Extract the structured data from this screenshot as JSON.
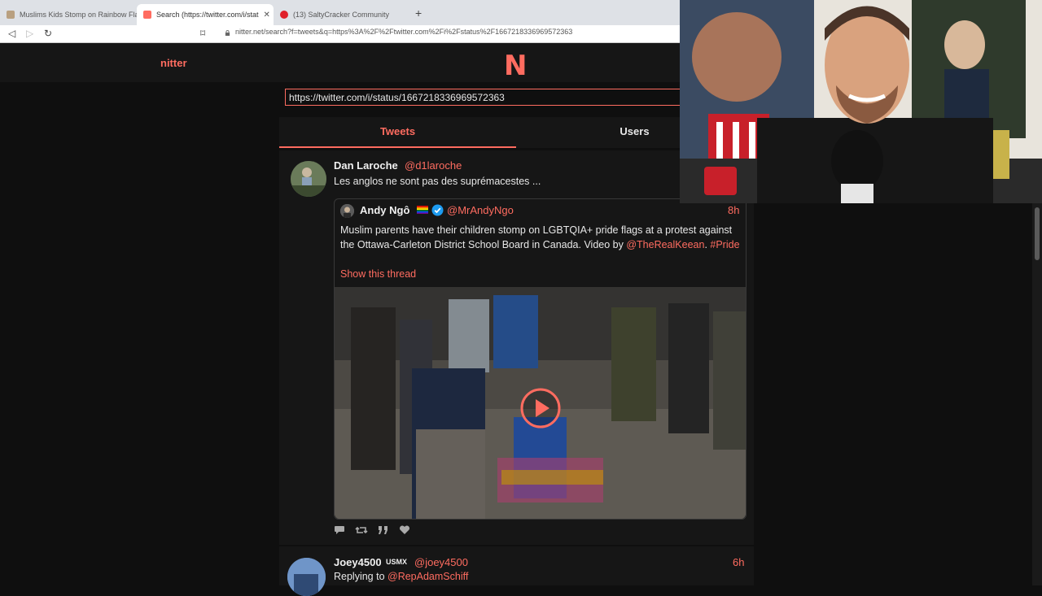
{
  "browser": {
    "tabs": [
      {
        "title": "Muslims Kids Stomp on Rainbow Flag"
      },
      {
        "title": "Search (https://twitter.com/i/stat"
      },
      {
        "title": "(13) SaltyCracker Community"
      }
    ],
    "new_tab_glyph": "+",
    "address": "nitter.net/search?f=tweets&q=https%3A%2F%2Ftwitter.com%2Fi%2Fstatus%2F1667218336969572363",
    "nav_glyphs": {
      "back": "◁",
      "forward": "▷",
      "reload": "↻",
      "bookmark": "⌑"
    }
  },
  "nitter": {
    "brand": "nitter",
    "logo_letter": "N",
    "search_value": "https://twitter.com/i/status/1667218336969572363",
    "tabs": {
      "tweets": "Tweets",
      "users": "Users"
    }
  },
  "tweet": {
    "name": "Dan Laroche",
    "handle": "@d1laroche",
    "text": "Les anglos ne sont pas des suprémacestes ...",
    "quote": {
      "name": "Andy Ngô",
      "handle": "@MrAndyNgo",
      "time": "8h",
      "text_part1": "Muslim parents have their children stomp on LGBTQIA+ pride flags at a protest against the Ottawa-Carleton District School Board in Canada. Video by ",
      "mention": "@TheRealKeean",
      "text_part2": ". ",
      "hashtag": "#Pride",
      "show_thread": "Show this thread"
    },
    "action_icons": [
      "comment-icon",
      "retweet-icon",
      "quote-icon",
      "heart-icon"
    ]
  },
  "tweet2": {
    "name": "Joey4500",
    "badge": "USMX",
    "handle": "@joey4500",
    "time": "6h",
    "replying_prefix": "Replying to ",
    "replying_to": "@RepAdamSchiff"
  },
  "colors": {
    "accent": "#ff6c60",
    "bg": "#0f0f0f",
    "panel": "#161616",
    "verified": "#1d9bf0"
  }
}
